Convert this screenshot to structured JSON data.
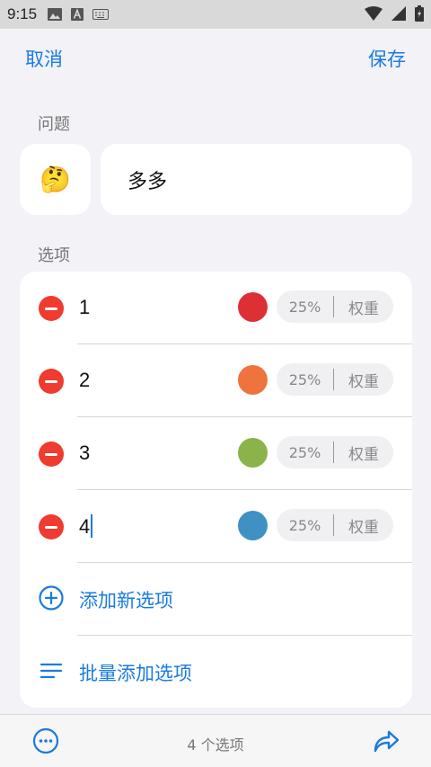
{
  "status_bar": {
    "time": "9:15"
  },
  "toolbar": {
    "cancel_label": "取消",
    "save_label": "保存"
  },
  "question": {
    "section_label": "问题",
    "emoji": "🤔",
    "text": "多多"
  },
  "options": {
    "section_label": "选项",
    "items": [
      {
        "text": "1",
        "color": "#dc3035",
        "weight_percent": "25%",
        "weight_label": "权重"
      },
      {
        "text": "2",
        "color": "#ee733d",
        "weight_percent": "25%",
        "weight_label": "权重"
      },
      {
        "text": "3",
        "color": "#8ab44a",
        "weight_percent": "25%",
        "weight_label": "权重"
      },
      {
        "text": "4",
        "color": "#3e91c0",
        "weight_percent": "25%",
        "weight_label": "权重"
      }
    ],
    "add_new_label": "添加新选项",
    "bulk_add_label": "批量添加选项"
  },
  "bottom_bar": {
    "count_text": "4 个选项"
  },
  "colors": {
    "accent": "#1a7ae0",
    "remove": "#ef3b30"
  }
}
